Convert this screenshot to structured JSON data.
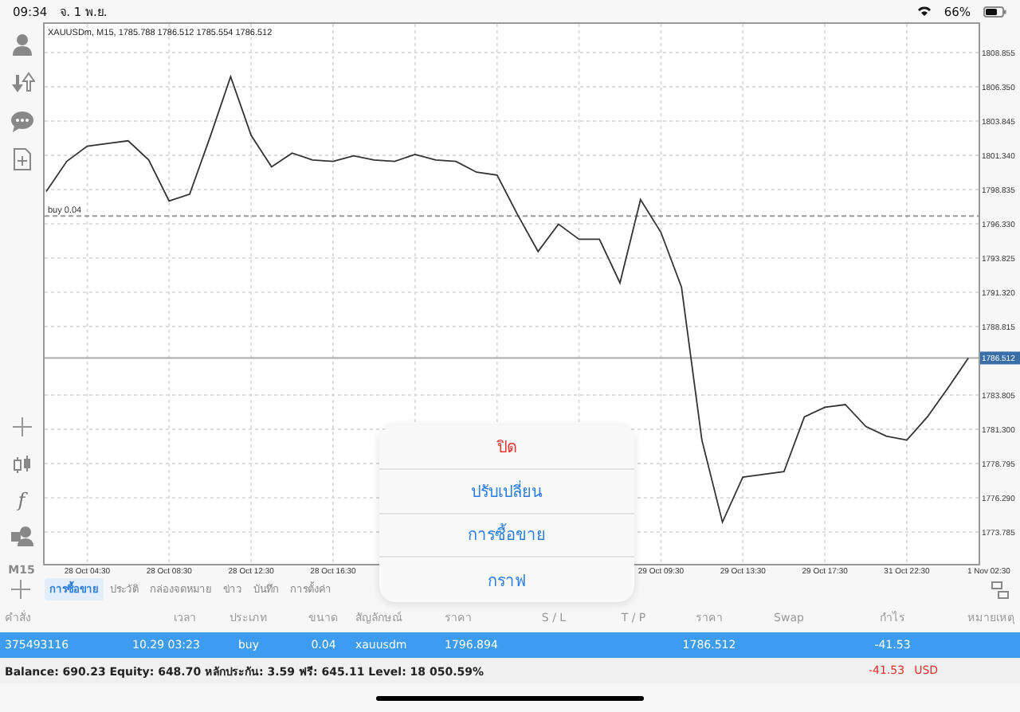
{
  "status_bar": {
    "time": "09:34",
    "date": "จ. 1 พ.ย.",
    "battery": "66%"
  },
  "toolbar": {
    "function_symbol": "f",
    "timeframe": "M15"
  },
  "chart": {
    "title": "XAUUSDm, M15, 1785.788 1786.512 1785.554 1786.512",
    "chart_data": {
      "type": "line",
      "grid": true,
      "ylim": [
        1771.45,
        1811.07
      ],
      "yticks": [
        {
          "value": 1808.855,
          "label": "1808.855"
        },
        {
          "value": 1806.35,
          "label": "1806.350"
        },
        {
          "value": 1803.845,
          "label": "1803.845"
        },
        {
          "value": 1801.34,
          "label": "1801.340"
        },
        {
          "value": 1798.835,
          "label": "1798.835"
        },
        {
          "value": 1796.33,
          "label": "1796.330"
        },
        {
          "value": 1793.825,
          "label": "1793.825"
        },
        {
          "value": 1791.32,
          "label": "1791.320"
        },
        {
          "value": 1788.815,
          "label": "1788.815"
        },
        {
          "value": 1783.805,
          "label": "1783.805"
        },
        {
          "value": 1781.3,
          "label": "1781.300"
        },
        {
          "value": 1778.795,
          "label": "1778.795"
        },
        {
          "value": 1776.29,
          "label": "1776.290"
        },
        {
          "value": 1773.785,
          "label": "1773.785"
        }
      ],
      "categories": [
        null,
        null,
        "28 Oct 04:30",
        null,
        null,
        null,
        "28 Oct 08:30",
        null,
        null,
        null,
        "28 Oct 12:30",
        null,
        null,
        null,
        "28 Oct 16:30",
        null,
        null,
        null,
        null,
        null,
        null,
        null,
        null,
        null,
        null,
        null,
        null,
        null,
        null,
        null,
        "29 Oct 09:30",
        null,
        null,
        null,
        "29 Oct 13:30",
        null,
        null,
        null,
        "29 Oct 17:30",
        null,
        null,
        null,
        "31 Oct 22:30",
        null,
        null,
        null,
        "1 Nov 02:30"
      ],
      "series": [
        {
          "color": "#333333",
          "values": [
            1798.7,
            1800.9,
            1802.0,
            1802.2,
            1802.4,
            1801.0,
            1798.0,
            1798.5,
            1802.7,
            1807.1,
            1802.8,
            1800.5,
            1801.5,
            1801.0,
            1800.9,
            1801.3,
            1801.0,
            1800.9,
            1801.4,
            1801.0,
            1800.9,
            1800.1,
            1799.9,
            1797.0,
            1794.3,
            1796.3,
            1795.2,
            1795.2,
            1792.0,
            1798.1,
            1795.7,
            1791.7,
            1780.5,
            1774.5,
            1777.8,
            1778.0,
            1778.2,
            1782.2,
            1782.9,
            1783.1,
            1781.5,
            1780.8,
            1780.5,
            1782.2,
            1784.3,
            1786.5,
            null
          ]
        }
      ],
      "ref_lines": [
        {
          "axis": "y",
          "value": 1796.894,
          "label": "buy 0.04"
        },
        {
          "axis": "y",
          "value": 1786.512,
          "label": "1786.512"
        }
      ]
    }
  },
  "tabs": [
    {
      "label": "การซื้อขาย",
      "selected": true
    },
    {
      "label": "ประวัติ",
      "selected": false
    },
    {
      "label": "กล่องจดหมาย",
      "selected": false
    },
    {
      "label": "ข่าว",
      "selected": false
    },
    {
      "label": "บันทึก",
      "selected": false
    },
    {
      "label": "การตั้งค่า",
      "selected": false
    }
  ],
  "table": {
    "columns": [
      "คำสั่ง",
      "เวลา",
      "ประเภท",
      "ขนาด",
      "สัญลักษณ์",
      "ราคา",
      "S / L",
      "T / P",
      "ราคา",
      "Swap",
      "กำไร",
      "หมายเหตุ"
    ],
    "rows": [
      {
        "selected": true,
        "order": "375493116",
        "time": "10.29 03:23",
        "type": "buy",
        "volume": "0.04",
        "symbol": "xauusdm",
        "open_price": "1796.894",
        "price": "1786.512",
        "profit": "-41.53"
      }
    ]
  },
  "summary": {
    "text": "Balance: 690.23 Equity: 648.70 หลักประกัน: 3.59 ฟรี: 645.11 Level: 18 050.59%",
    "profit": "-41.53",
    "currency": "USD"
  },
  "popup_menu": {
    "items": [
      {
        "label": "ปิด",
        "kind": "destructive"
      },
      {
        "label": "ปรับเปลี่ยน",
        "kind": "normal"
      },
      {
        "label": "การซื้อขาย",
        "kind": "normal"
      },
      {
        "label": "กราฟ",
        "kind": "normal"
      }
    ]
  }
}
